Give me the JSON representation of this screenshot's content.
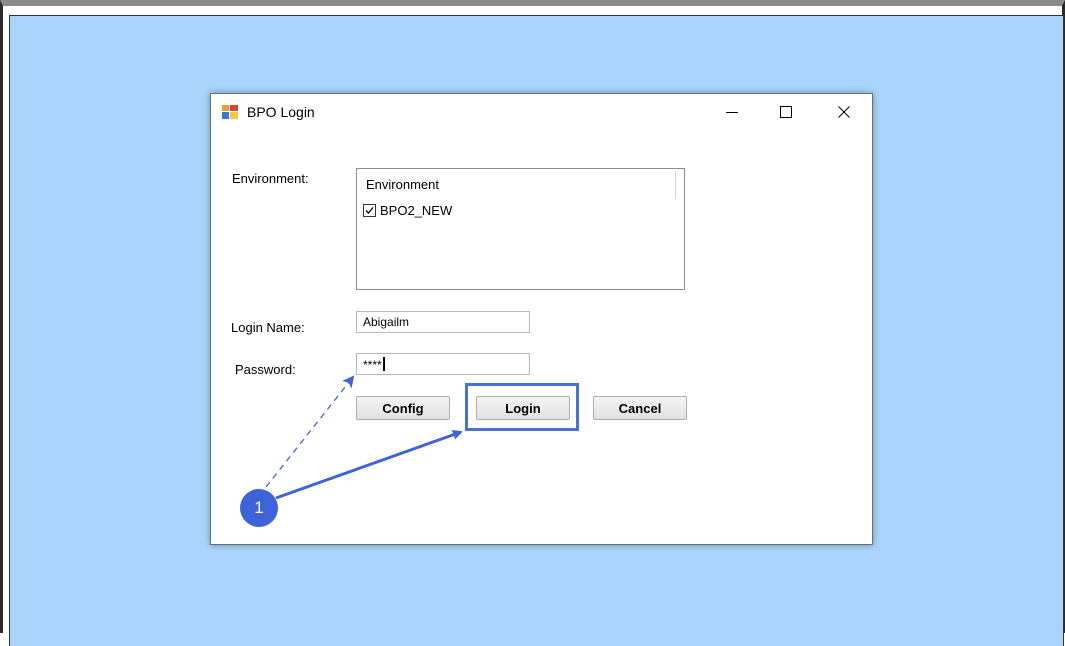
{
  "window": {
    "title": "BPO Login",
    "controls": {
      "minimize": "minimize-icon",
      "maximize": "maximize-icon",
      "close": "close-icon"
    }
  },
  "form": {
    "environment_label": "Environment:",
    "environment_list": {
      "header": "Environment",
      "items": [
        {
          "label": "BPO2_NEW",
          "checked": true
        }
      ]
    },
    "login_name_label": "Login Name:",
    "login_name_value": "Abigailm",
    "password_label": "Password:",
    "password_value": "****"
  },
  "buttons": {
    "config": "Config",
    "login": "Login",
    "cancel": "Cancel"
  },
  "annotation": {
    "step_number": "1",
    "highlight_color": "#4a72d6",
    "badge_color": "#3e62d8"
  },
  "colors": {
    "desktop_background": "#aad4fb",
    "window_background": "#ffffff"
  }
}
